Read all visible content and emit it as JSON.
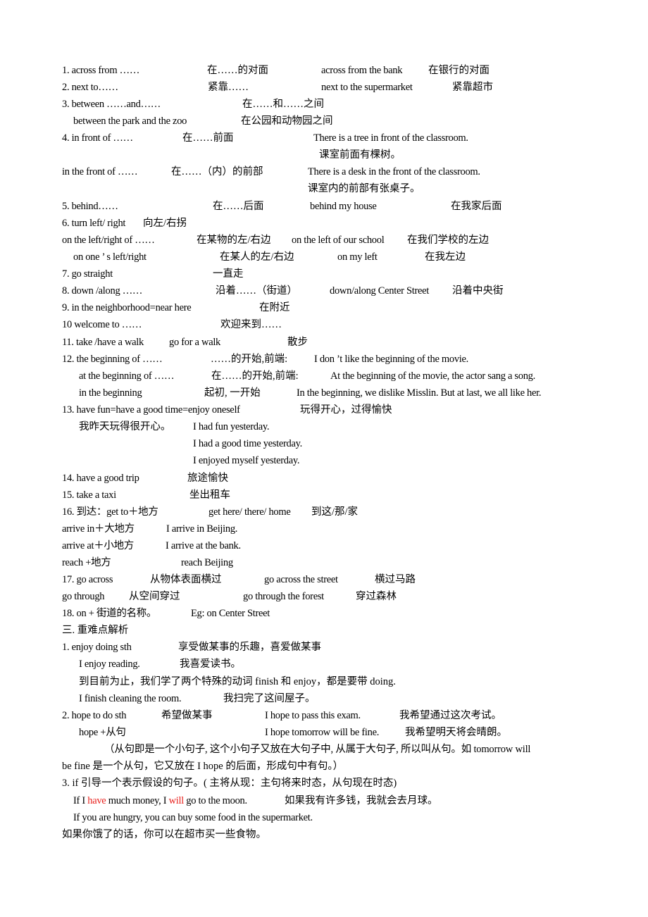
{
  "document": {
    "colors": {
      "text": "#000000",
      "highlight": "#e8231f",
      "background": "#ffffff"
    },
    "lines": [
      {
        "id": "l1",
        "cells": [
          "1. across from   ……",
          "在……的对面",
          "across from the bank",
          "在银行的对面"
        ]
      },
      {
        "id": "l2",
        "cells": [
          "2. next to……",
          "紧靠……",
          "next to the supermarket",
          "紧靠超市"
        ]
      },
      {
        "id": "l3",
        "cells": [
          "3. between ……and……",
          "在……和……之间"
        ]
      },
      {
        "id": "l4",
        "cells": [
          "between the park and the zoo",
          "在公园和动物园之间"
        ]
      },
      {
        "id": "l5",
        "cells": [
          "4. in front of ……",
          "在……前面",
          "There is a tree in front of the classroom."
        ]
      },
      {
        "id": "l6",
        "cells": [
          "课室前面有棵树。"
        ]
      },
      {
        "id": "l7",
        "cells": [
          "in the front of ……",
          "在……（内）的前部",
          "There is a desk in the front of the classroom."
        ]
      },
      {
        "id": "l8",
        "cells": [
          "课室内的前部有张桌子。"
        ]
      },
      {
        "id": "l9",
        "cells": [
          "5. behind……",
          "在……后面",
          "behind my house",
          "在我家后面"
        ]
      },
      {
        "id": "l10",
        "cells": [
          "6. turn left/ right",
          "向左/右拐"
        ]
      },
      {
        "id": "l11",
        "cells": [
          "on the left/right of ……",
          "在某物的左/右边",
          "on the left of our school",
          "在我们学校的左边"
        ]
      },
      {
        "id": "l12",
        "cells": [
          "on one ’ s left/right",
          "在某人的左/右边",
          "on my left",
          "在我左边"
        ]
      },
      {
        "id": "l13",
        "cells": [
          "7. go straight",
          "一直走"
        ]
      },
      {
        "id": "l14",
        "cells": [
          "8. down /along ……",
          "沿着……（街道）",
          "down/along Center Street",
          "沿着中央街"
        ]
      },
      {
        "id": "l15",
        "cells": [
          "9. in the neighborhood=near here",
          "在附近"
        ]
      },
      {
        "id": "l16",
        "cells": [
          "10 welcome to ……",
          "欢迎来到……"
        ]
      },
      {
        "id": "l17",
        "cells": [
          "11. take /have a walk",
          "go for a walk",
          "散步"
        ]
      },
      {
        "id": "l18",
        "cells": [
          "12. the beginning of ……",
          "……的开始,前端:",
          "I don ’t like the beginning of the movie."
        ]
      },
      {
        "id": "l19",
        "cells": [
          "at the beginning of ……",
          "在……的开始,前端:",
          "At the beginning of the movie, the actor sang a song."
        ]
      },
      {
        "id": "l20",
        "cells": [
          "in the beginning",
          "起初, 一开始",
          "In the beginning, we dislike Misslin. But at last, we all like her."
        ]
      },
      {
        "id": "l21",
        "cells": [
          "13. have fun=have a good time=enjoy oneself",
          "玩得开心，过得愉快"
        ]
      },
      {
        "id": "l22",
        "cells": [
          "我昨天玩得很开心。",
          "I had fun yesterday."
        ]
      },
      {
        "id": "l23",
        "cells": [
          "I had a good time yesterday."
        ]
      },
      {
        "id": "l24",
        "cells": [
          "I enjoyed myself yesterday."
        ]
      },
      {
        "id": "l25",
        "cells": [
          "14. have a good trip",
          "旅途愉快"
        ]
      },
      {
        "id": "l26",
        "cells": [
          "15. take a taxi",
          "坐出租车"
        ]
      },
      {
        "id": "l27",
        "cells": [
          "16.  到达：get to＋地方",
          "get here/ there/ home",
          "到这/那/家"
        ]
      },
      {
        "id": "l28",
        "cells": [
          "arrive in＋大地方",
          "I arrive in Beijing."
        ]
      },
      {
        "id": "l29",
        "cells": [
          "arrive at＋小地方",
          "I arrive at the bank."
        ]
      },
      {
        "id": "l30",
        "cells": [
          "reach +地方",
          "reach Beijing"
        ]
      },
      {
        "id": "l31",
        "cells": [
          "17.   go across",
          "从物体表面横过",
          "go across the street",
          "横过马路"
        ]
      },
      {
        "id": "l32",
        "cells": [
          "go through",
          "从空间穿过",
          "go through the forest",
          "穿过森林"
        ]
      },
      {
        "id": "l33",
        "cells": [
          "18.   on +  街道的名称。",
          "Eg: on Center Street"
        ]
      },
      {
        "id": "l34",
        "cells": [
          "三.   重难点解析"
        ]
      },
      {
        "id": "l35",
        "cells": [
          "1.   enjoy doing sth",
          "享受做某事的乐趣，喜爱做某事"
        ]
      },
      {
        "id": "l36",
        "cells": [
          "I enjoy reading.",
          "我喜爱读书。"
        ]
      },
      {
        "id": "l37",
        "cells": [
          "到目前为止，我们学了两个特殊的动词 finish  和 enjoy，都是要带  doing."
        ]
      },
      {
        "id": "l38",
        "cells": [
          "I finish cleaning the room.",
          "我扫完了这间屋子。"
        ]
      },
      {
        "id": "l39",
        "cells": [
          "2.   hope to do sth",
          "希望做某事",
          "I hope to pass this exam.",
          "我希望通过这次考试。"
        ]
      },
      {
        "id": "l40",
        "cells": [
          "hope +从句",
          "I hope tomorrow will be fine.",
          "我希望明天将会晴朗。"
        ]
      },
      {
        "id": "l41",
        "cells": [
          "（从句即是一个小句子, 这个小句子又放在大句子中, 从属于大句子, 所以叫从句。如 tomorrow will"
        ]
      },
      {
        "id": "l42",
        "cells": [
          "be fine  是一个从句，它又放在 I hope  的后面，形成句中有句。）"
        ]
      },
      {
        "id": "l43",
        "cells": [
          "3. if  引导一个表示假设的句子。(  主将从现：主句将来时态，从句现在时态)"
        ]
      },
      {
        "id": "l44",
        "segments": [
          "If I ",
          "have",
          "  much money, I  ",
          "will",
          " go to the moon.",
          "如果我有许多钱，我就会去月球。"
        ]
      },
      {
        "id": "l45",
        "cells": [
          "If you are hungry, you can buy some food in the supermarket."
        ]
      },
      {
        "id": "l46",
        "cells": [
          "如果你饿了的话，你可以在超市买一些食物。"
        ]
      }
    ]
  }
}
